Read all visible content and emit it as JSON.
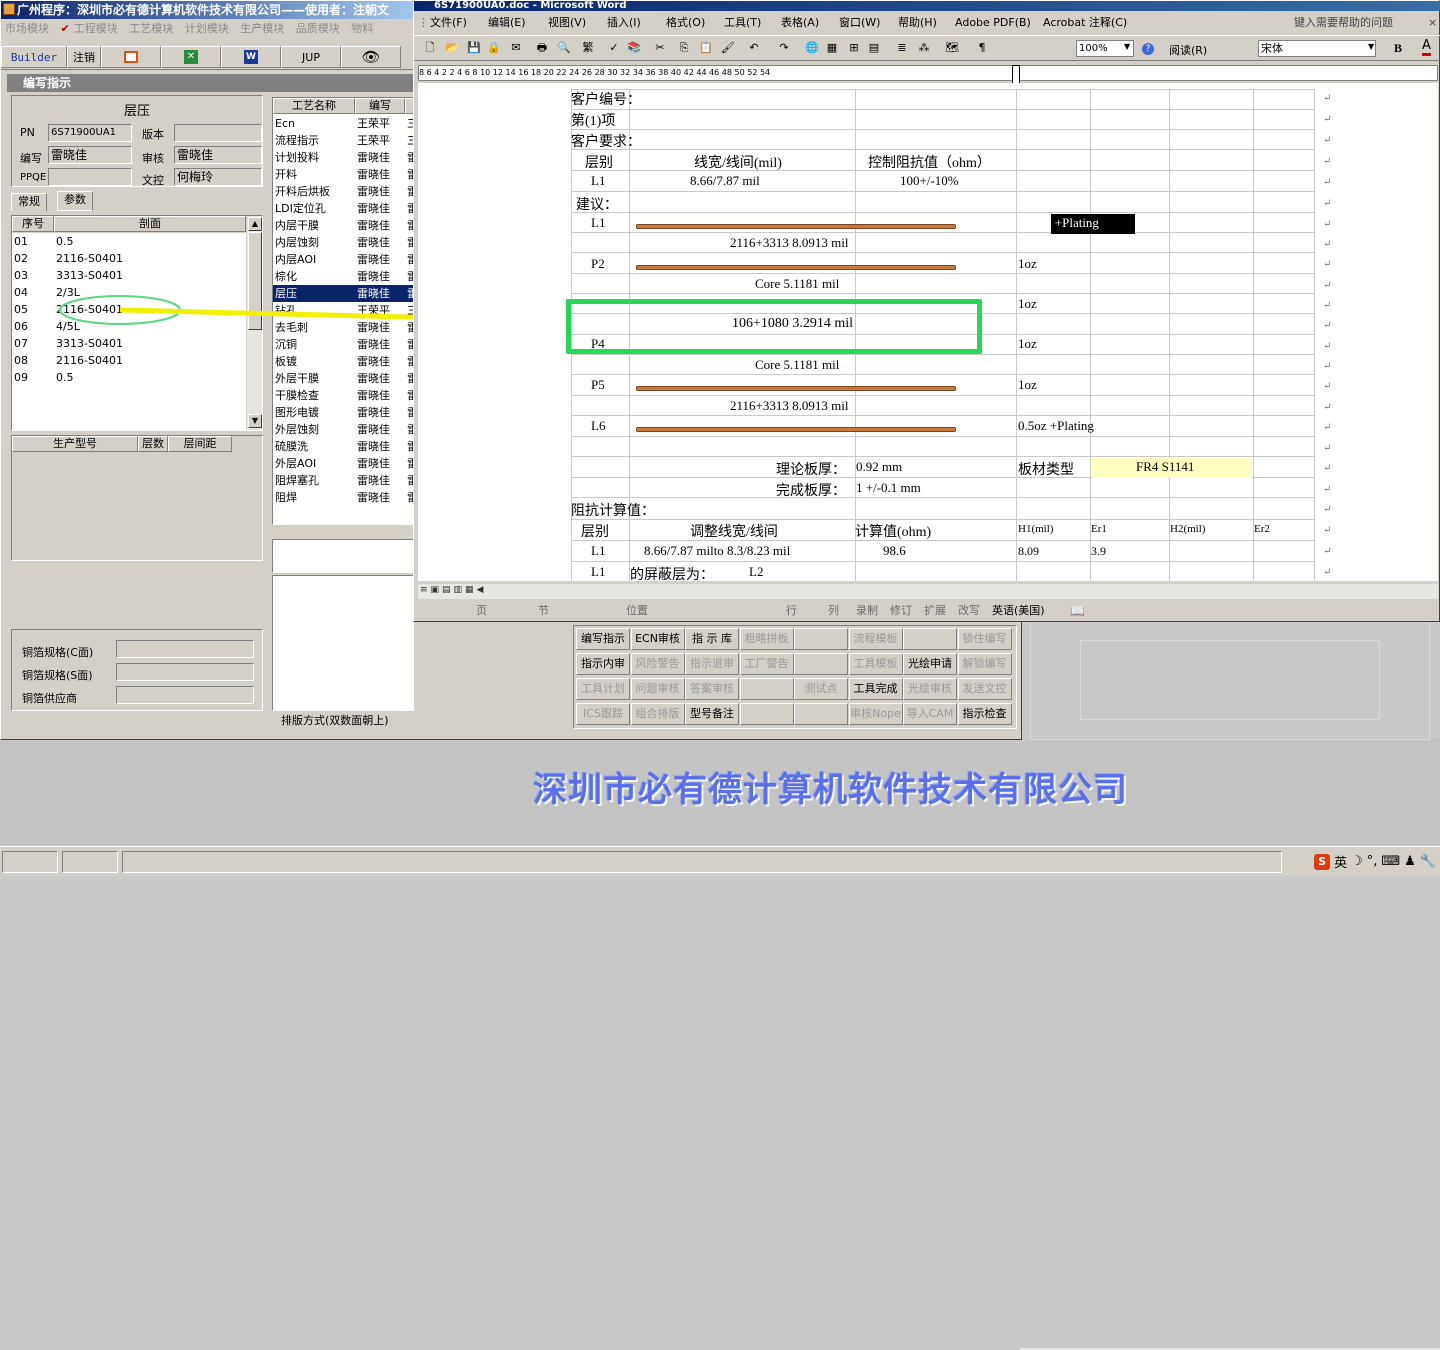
{
  "main_window": {
    "title": "广州程序：深圳市必有德计算机软件技术有限公司——使用者：注朝文",
    "menu": [
      "市场模块",
      "工程模块",
      "工艺模块",
      "计划模块",
      "生产模块",
      "品质模块",
      "物料"
    ],
    "toolbar": {
      "builder": "Builder",
      "logout": "注销",
      "jup": "JUP"
    },
    "subwindow_title": "编写指示"
  },
  "form": {
    "section": "层压",
    "pn_label": "PN",
    "pn_value": "6S71900UA1",
    "version_label": "版本",
    "version_value": "",
    "writer_label": "编写",
    "writer_value": "雷晓佳",
    "reviewer_label": "审核",
    "reviewer_value": "雷晓佳",
    "ppqe_label": "PPQE",
    "ppqe_value": "",
    "doc_control_label": "文控",
    "doc_control_value": "何梅玲"
  },
  "tabs": [
    "常规",
    "参数"
  ],
  "stack_list": {
    "headers": [
      "序号",
      "剖面"
    ],
    "rows": [
      {
        "no": "01",
        "profile": "0.5"
      },
      {
        "no": "02",
        "profile": "2116-S0401"
      },
      {
        "no": "03",
        "profile": "3313-S0401"
      },
      {
        "no": "04",
        "profile": "2/3L"
      },
      {
        "no": "05",
        "profile": "2116-S0401"
      },
      {
        "no": "06",
        "profile": "4/5L"
      },
      {
        "no": "07",
        "profile": "3313-S0401"
      },
      {
        "no": "08",
        "profile": "2116-S0401"
      },
      {
        "no": "09",
        "profile": "0.5"
      }
    ]
  },
  "production_list": {
    "headers": [
      "生产型号",
      "层数",
      "层间距"
    ]
  },
  "copper": {
    "top_label": "铜箔规格(C面)",
    "top_value": "",
    "bottom_label": "铜箔规格(S面)",
    "bottom_value": "",
    "supplier_label": "铜箔供应商",
    "supplier_value": ""
  },
  "process_list": {
    "headers": [
      "工艺名称",
      "编写"
    ],
    "rows": [
      {
        "name": "Ecn",
        "writer": "王荣平",
        "extra": "三"
      },
      {
        "name": "流程指示",
        "writer": "王荣平",
        "extra": "三"
      },
      {
        "name": "计划投料",
        "writer": "雷晓佳",
        "extra": "雷"
      },
      {
        "name": "开料",
        "writer": "雷晓佳",
        "extra": "雷"
      },
      {
        "name": "开料后烘板",
        "writer": "雷晓佳",
        "extra": "雷"
      },
      {
        "name": "LDI定位孔",
        "writer": "雷晓佳",
        "extra": "雷"
      },
      {
        "name": "内层干膜",
        "writer": "雷晓佳",
        "extra": "雷"
      },
      {
        "name": "内层蚀刻",
        "writer": "雷晓佳",
        "extra": "雷"
      },
      {
        "name": "内层AOI",
        "writer": "雷晓佳",
        "extra": "雷"
      },
      {
        "name": "棕化",
        "writer": "雷晓佳",
        "extra": "雷"
      },
      {
        "name": "层压",
        "writer": "雷晓佳",
        "extra": "雷"
      },
      {
        "name": "钻孔",
        "writer": "王荣平",
        "extra": "三"
      },
      {
        "name": "去毛刺",
        "writer": "雷晓佳",
        "extra": "雷"
      },
      {
        "name": "沉铜",
        "writer": "雷晓佳",
        "extra": "雷"
      },
      {
        "name": "板镀",
        "writer": "雷晓佳",
        "extra": "雷"
      },
      {
        "name": "外层干膜",
        "writer": "雷晓佳",
        "extra": "雷"
      },
      {
        "name": "干膜检查",
        "writer": "雷晓佳",
        "extra": "雷"
      },
      {
        "name": "图形电镀",
        "writer": "雷晓佳",
        "extra": "雷"
      },
      {
        "name": "外层蚀刻",
        "writer": "雷晓佳",
        "extra": "雷"
      },
      {
        "name": "硫膜洗",
        "writer": "雷晓佳",
        "extra": "雷"
      },
      {
        "name": "外层AOI",
        "writer": "雷晓佳",
        "extra": "雷"
      },
      {
        "name": "阻焊塞孔",
        "writer": "雷晓佳",
        "extra": "雷"
      },
      {
        "name": "阻焊",
        "writer": "雷晓佳",
        "extra": "雷"
      }
    ],
    "selected_index": 10,
    "layout_label": "排版方式(双数面朝上)"
  },
  "action_buttons": [
    {
      "label": "编写指示",
      "enabled": true
    },
    {
      "label": "ECN审核",
      "enabled": true
    },
    {
      "label": "指 示 库",
      "enabled": true
    },
    {
      "label": "粗略拼板",
      "enabled": false
    },
    {
      "label": "",
      "enabled": false
    },
    {
      "label": "流程模板",
      "enabled": false
    },
    {
      "label": "",
      "enabled": false
    },
    {
      "label": "锁住编写",
      "enabled": false
    },
    {
      "label": "指示内审",
      "enabled": true
    },
    {
      "label": "风险警告",
      "enabled": false
    },
    {
      "label": "指示退审",
      "enabled": false
    },
    {
      "label": "工厂警告",
      "enabled": false
    },
    {
      "label": "",
      "enabled": false
    },
    {
      "label": "工具模板",
      "enabled": false
    },
    {
      "label": "光绘申请",
      "enabled": true
    },
    {
      "label": "解锁编写",
      "enabled": false
    },
    {
      "label": "工具计划",
      "enabled": false
    },
    {
      "label": "问题审核",
      "enabled": false
    },
    {
      "label": "答案审核",
      "enabled": false
    },
    {
      "label": "",
      "enabled": false
    },
    {
      "label": "测试点",
      "enabled": false
    },
    {
      "label": "工具完成",
      "enabled": true
    },
    {
      "label": "光绘审核",
      "enabled": false
    },
    {
      "label": "发送文控",
      "enabled": false
    },
    {
      "label": "ICS跟踪",
      "enabled": false
    },
    {
      "label": "组合排版",
      "enabled": false
    },
    {
      "label": "型号备注",
      "enabled": true
    },
    {
      "label": "",
      "enabled": false
    },
    {
      "label": "",
      "enabled": false
    },
    {
      "label": "审核Nope",
      "enabled": false
    },
    {
      "label": "导入CAM",
      "enabled": false
    },
    {
      "label": "指示检查",
      "enabled": true
    }
  ],
  "company_banner": "深圳市必有德计算机软件技术有限公司",
  "word": {
    "title": "6S71900UA0.doc - Microsoft Word",
    "menu": [
      "文件(F)",
      "编辑(E)",
      "视图(V)",
      "插入(I)",
      "格式(O)",
      "工具(T)",
      "表格(A)",
      "窗口(W)",
      "帮助(H)",
      "Adobe PDF(B)",
      "Acrobat 注释(C)"
    ],
    "help_box": "键入需要帮助的问题",
    "zoom": "100%",
    "read_label": "阅读(R)",
    "font": "宋体",
    "bold": "B",
    "font_color": "A",
    "ruler_text": "8  6  4  2     2  4  6  8  10  12  14  16  18  20  22  24  26  28  30  32  34  36  38  40  42  44  46  48  50  52  54",
    "status": [
      "页",
      "节",
      "位置",
      "行",
      "列",
      "录制",
      "修订",
      "扩展",
      "改写",
      "英语(美国)"
    ]
  },
  "doc": {
    "customer_no_label": "客户编号：",
    "item_label": "第(1)项",
    "customer_req_label": "客户要求：",
    "imp_headers": {
      "layer": "层别",
      "line": "线宽/线间(mil)",
      "impedance": "控制阻抗值（ohm）"
    },
    "imp_row": {
      "layer": "L1",
      "line": "8.66/7.87 mil",
      "impedance": "100+/-10%"
    },
    "suggest_label": "建议：",
    "stack": {
      "L1": "L1",
      "L1_copper": "0.5oz +Plating",
      "pp1": "2116+3313    8.0913 mil",
      "P2": "P2",
      "P2_copper": "1oz",
      "core1": "Core   5.1181 mil",
      "P3_copper": "1oz",
      "pp2": "106+1080    3.2914 mil",
      "P4": "P4",
      "P4_copper": "1oz",
      "core2": "Core   5.1181 mil",
      "P5": "P5",
      "P5_copper": "1oz",
      "pp3": "2116+3313    8.0913 mil",
      "L6": "L6",
      "L6_copper": "0.5oz +Plating"
    },
    "theory_label": "理论板厚：",
    "theory_value": "0.92 mm",
    "material_label": "板材类型",
    "material_value": "FR4 S1141",
    "finish_label": "完成板厚：",
    "finish_value": "1 +/-0.1 mm",
    "calc_label": "阻抗计算值：",
    "calc_headers": {
      "layer": "层别",
      "adj": "调整线宽/线间",
      "calc": "计算值(ohm)",
      "h1": "H1(mil)",
      "er1": "Er1",
      "h2": "H2(mil)",
      "er2": "Er2"
    },
    "calc_row": {
      "layer": "L1",
      "adj": "8.66/7.87 milto 8.3/8.23 mil",
      "calc": "98.6",
      "h1": "8.09",
      "er1": "3.9"
    },
    "shield_row": {
      "layer": "L1",
      "label": "的屏蔽层为：",
      "value": "L2"
    }
  },
  "ime": {
    "label": "英"
  },
  "colors": {
    "title_blue": "#0a246a",
    "highlight_green": "#2ad65a",
    "arrow_yellow": "#f0f000",
    "copper": "#c87a40",
    "selection_navy": "#0a246a",
    "banner_blue": "#5870e8"
  }
}
